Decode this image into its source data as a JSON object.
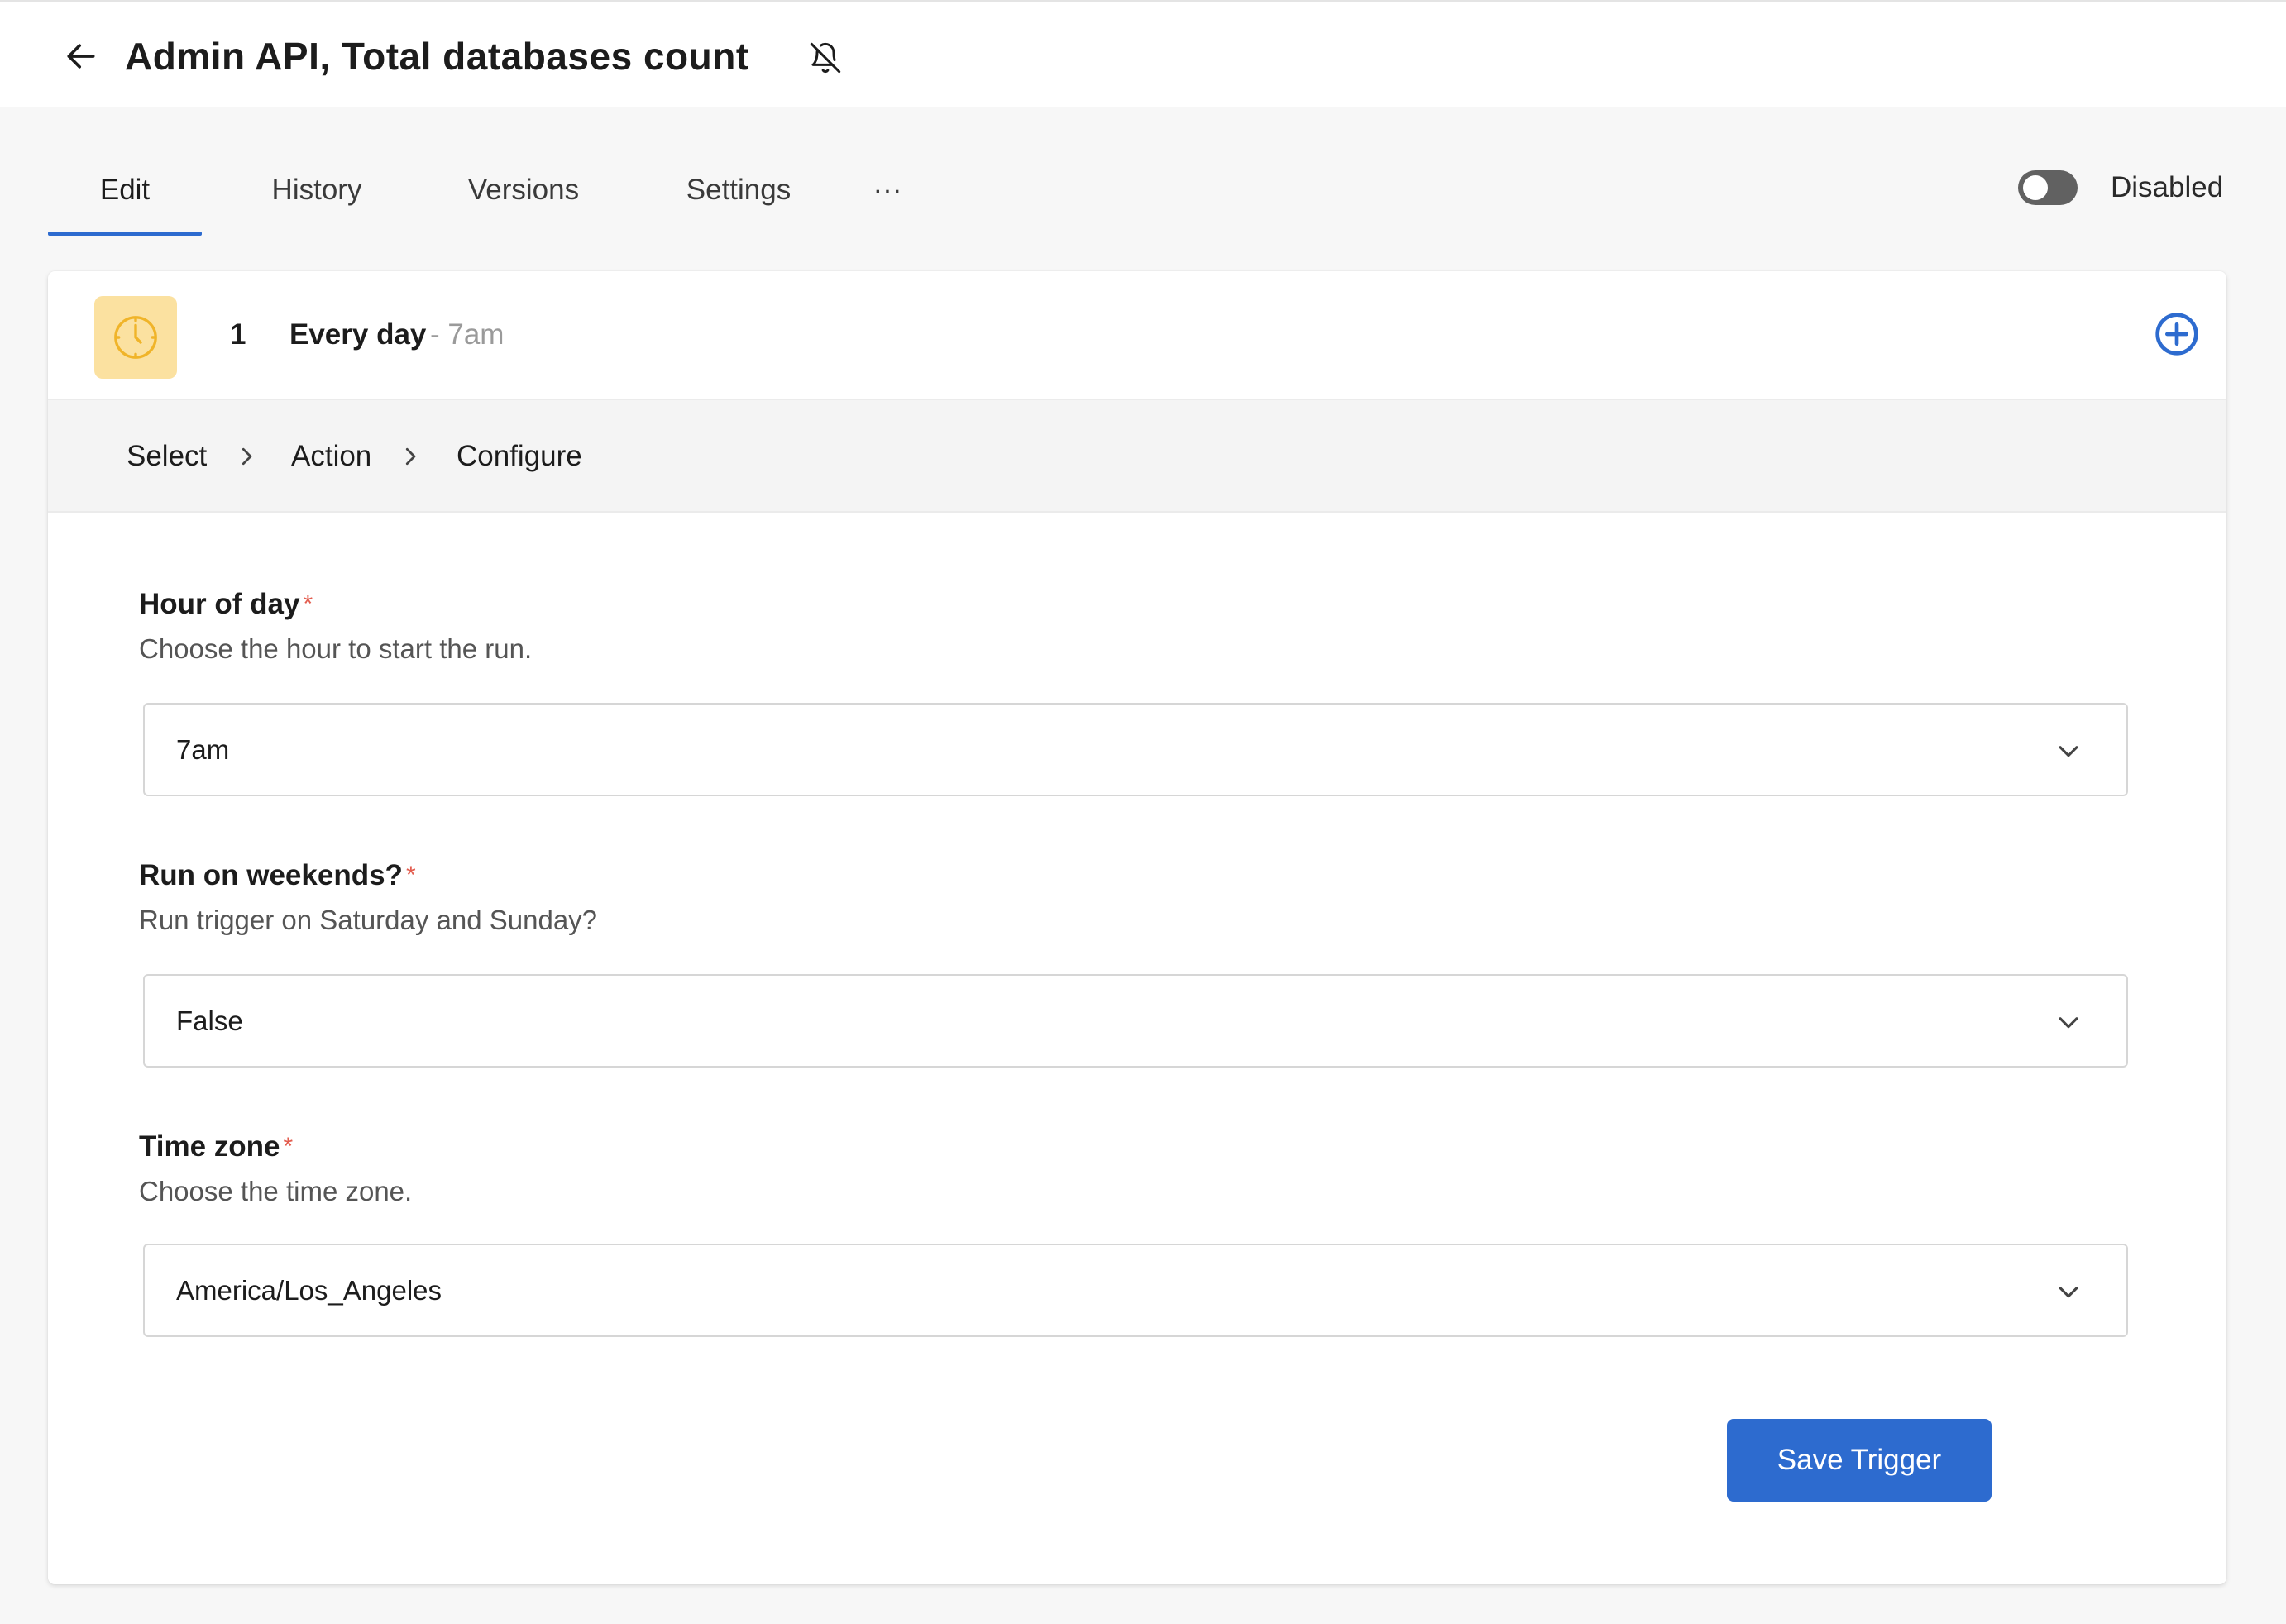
{
  "header": {
    "title": "Admin API, Total databases count",
    "back_icon": "arrow-left-icon",
    "notification_icon": "bell-off-icon"
  },
  "tabs": [
    {
      "label": "Edit",
      "active": true
    },
    {
      "label": "History",
      "active": false
    },
    {
      "label": "Versions",
      "active": false
    },
    {
      "label": "Settings",
      "active": false
    },
    {
      "label": "···",
      "active": false
    }
  ],
  "status_toggle": {
    "label": "Disabled",
    "enabled": false
  },
  "step": {
    "number": "1",
    "title": "Every day",
    "subtitle": "- 7am",
    "icon": "clock-icon",
    "add_icon": "plus-circle-icon"
  },
  "breadcrumb": [
    "Select",
    "Action",
    "Configure"
  ],
  "fields": [
    {
      "label": "Hour of day",
      "required_mark": "*",
      "help": "Choose the hour to start the run.",
      "value": "7am"
    },
    {
      "label": "Run on weekends?",
      "required_mark": "*",
      "help": "Run trigger on Saturday and Sunday?",
      "value": "False"
    },
    {
      "label": "Time zone",
      "required_mark": "*",
      "help": "Choose the time zone.",
      "value": "America/Los_Angeles"
    }
  ],
  "actions": {
    "save_label": "Save Trigger"
  },
  "colors": {
    "accent": "#2d6bcf",
    "required": "#e35d4f",
    "clock_badge": "#fbe1a0",
    "clock_stroke": "#f0b429"
  }
}
